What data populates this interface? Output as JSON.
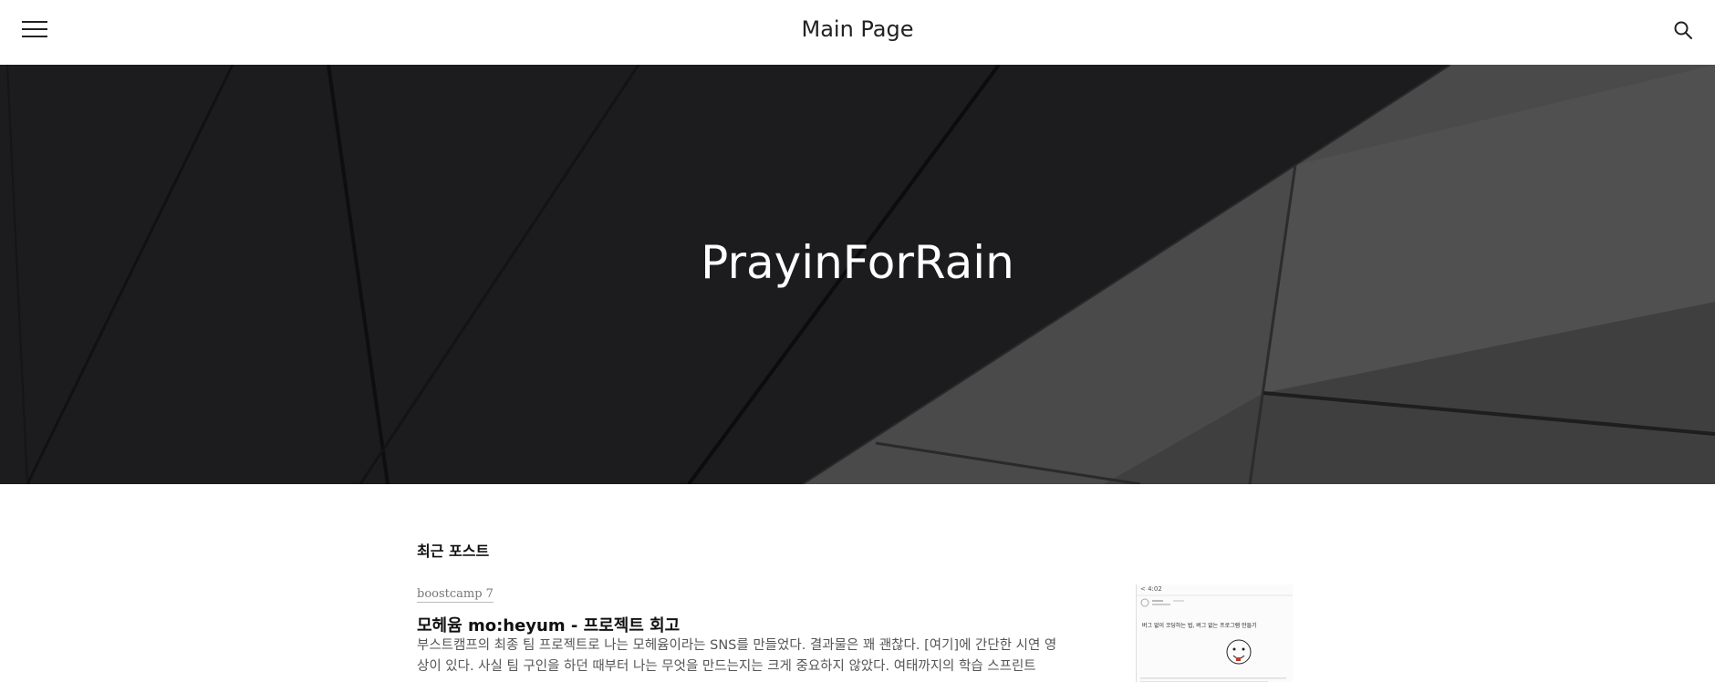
{
  "header": {
    "title": "Main Page",
    "menu_icon": "hamburger-menu-icon",
    "search_icon": "search-icon"
  },
  "hero": {
    "title": "PrayinForRain"
  },
  "main": {
    "section_title": "최근 포스트",
    "posts": [
      {
        "category": "boostcamp 7",
        "title": "모헤윰 mo:heyum - 프로젝트 회고",
        "excerpt": "부스트캠프의 최종 팀 프로젝트로 나는 모헤윰이라는 SNS를 만들었다. 결과물은 꽤 괜찮다. [여기]에 간단한 시연 영상이 있다. 사실 팀 구인을 하던 때부터 나는 무엇을 만드는지는 크게 중요하지 않았다. 여태까지의 학습 스프린트",
        "thumbnail": {
          "status_time": "< 4:02",
          "caption": "버그 없이 코딩하는 법, 버그 없는 프로그램 만들기"
        }
      }
    ]
  },
  "colors": {
    "hero_dark": "#1c1c1e",
    "hero_light": "#4a4a4a",
    "text_main": "#111111",
    "text_muted": "#555555"
  }
}
